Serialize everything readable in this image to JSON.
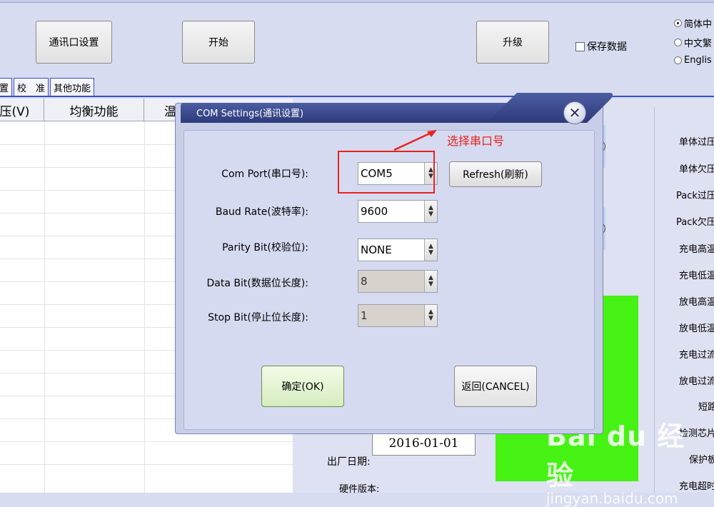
{
  "toolbar": {
    "comm_settings": "通讯口设置",
    "start": "开始",
    "upgrade": "升级",
    "save_data": "保存数据"
  },
  "language": {
    "options": [
      "简体中",
      "中文繁",
      "Englis"
    ],
    "selected": "简体中"
  },
  "tabs": [
    "置",
    "校　准",
    "其他功能"
  ],
  "grid": {
    "headers": [
      "压(V)",
      "均衡功能",
      "温"
    ]
  },
  "right_labels": [
    "单体过压",
    "单体欠压",
    "Pack过压",
    "Pack欠压",
    "充电高温",
    "充电低温",
    "放电高温",
    "放电低温",
    "充电过流",
    "放电过流",
    "短路",
    "检测芯片",
    "保护板",
    "充电超时"
  ],
  "factory": {
    "label": "出厂日期:",
    "date": "2016-01-01",
    "hw_label": "硬件版本:"
  },
  "dialog": {
    "title": "COM Settings(通讯设置)",
    "close_glyph": "✕",
    "fields": [
      {
        "label": "Com Port(串口号):",
        "value": "COM5",
        "disabled": false
      },
      {
        "label": "Baud Rate(波特率):",
        "value": "9600",
        "disabled": false
      },
      {
        "label": "Parity Bit(校验位):",
        "value": "NONE",
        "disabled": false
      },
      {
        "label": "Data Bit(数据位长度):",
        "value": "8",
        "disabled": true
      },
      {
        "label": "Stop Bit(停止位长度):",
        "value": "1",
        "disabled": true
      }
    ],
    "refresh": "Refresh(刷新)",
    "ok": "确定(OK)",
    "cancel": "返回(CANCEL)"
  },
  "annotation": {
    "text": "选择串口号",
    "color": "#e8231e"
  },
  "watermark": {
    "logo": "Bai du 经验",
    "url": "jingyan.baidu.com"
  },
  "colors": {
    "tab_border": "#3c4fc0",
    "status_green": "#45f214",
    "dialog_title": "#2e3a79"
  }
}
